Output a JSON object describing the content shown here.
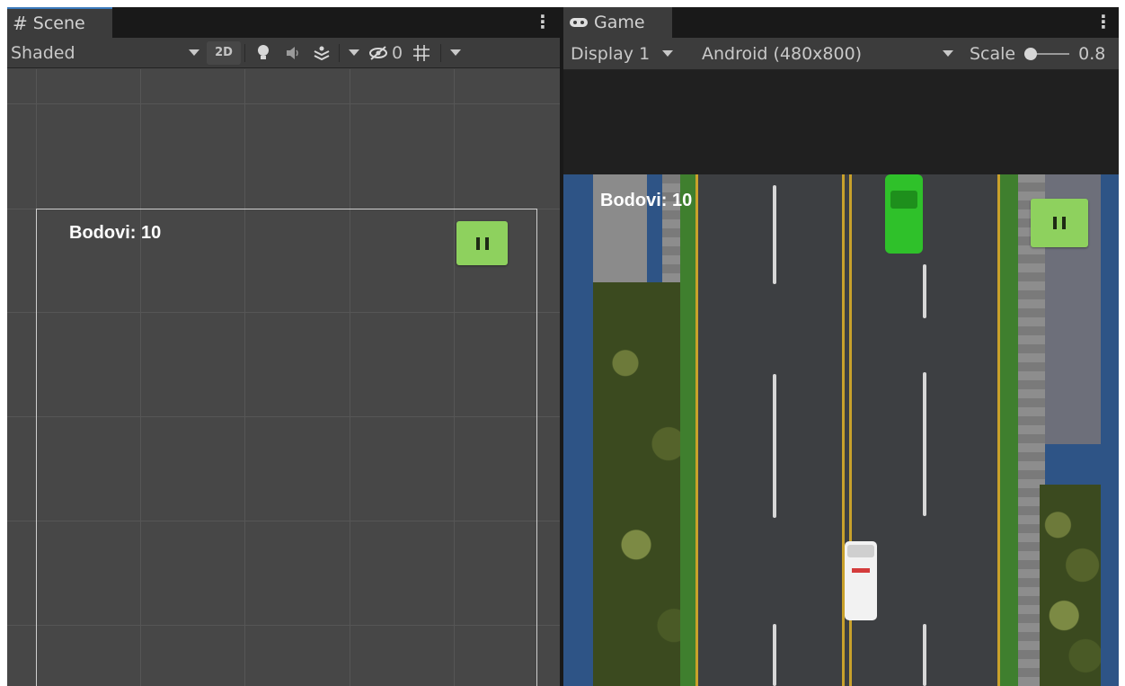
{
  "scene": {
    "tab_icon": "#",
    "tab_label": "Scene",
    "menu_icon": "⋮",
    "shading_mode": "Shaded",
    "btn_2d": "2D",
    "hidden_count": "0"
  },
  "game": {
    "tab_label": "Game",
    "menu_icon": "⋮",
    "display": "Display 1",
    "resolution": "Android (480x800)",
    "scale_label": "Scale",
    "scale_value": "0.8"
  },
  "hud": {
    "score_label": "Bodovi: 10"
  },
  "icons": {
    "scene_tab": "grid-hash-icon",
    "game_tab": "gamepad-icon",
    "lighting": "lightbulb-icon",
    "audio": "speaker-icon",
    "effects": "effects-icon",
    "visibility": "hidden-eye-icon",
    "grid_toggle": "grid-toggle-icon",
    "pause": "pause-icon"
  },
  "colors": {
    "panel_bg": "#464646",
    "toolbar_bg": "#3c3c3c",
    "tab_accent": "#3a79bb",
    "pause_button": "#8ed15e",
    "game_letterbox": "#2e5486",
    "green_car": "#2fc12a"
  }
}
